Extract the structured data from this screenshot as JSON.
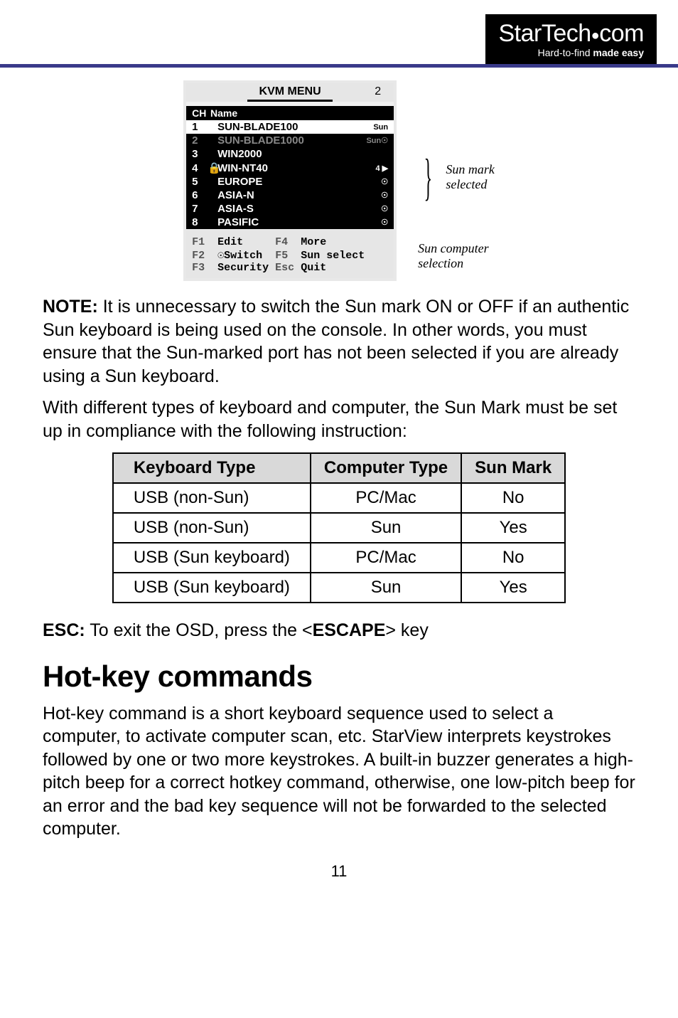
{
  "logo": {
    "main_a": "Star",
    "main_b": "Tech",
    "main_c": "com",
    "dot": "●",
    "sub_prefix": "Hard-to-find ",
    "sub_bold": "made easy"
  },
  "kvm": {
    "title": "KVM MENU",
    "page_num": "2",
    "header_ch": "CH",
    "header_name": "Name",
    "rows": [
      {
        "ch": "1",
        "lock": "",
        "name": "SUN-BLADE100",
        "mark": "Sun",
        "cls": "highlight"
      },
      {
        "ch": "2",
        "lock": "",
        "name": "SUN-BLADE1000",
        "mark": "Sun☉",
        "cls": "dim"
      },
      {
        "ch": "3",
        "lock": "",
        "name": "WIN2000",
        "mark": "",
        "cls": ""
      },
      {
        "ch": "4",
        "lock": "🔒",
        "name": "WIN-NT40",
        "mark": "4 ▶",
        "cls": ""
      },
      {
        "ch": "5",
        "lock": "",
        "name": "EUROPE",
        "mark": "☉",
        "cls": ""
      },
      {
        "ch": "6",
        "lock": "",
        "name": "ASIA-N",
        "mark": "☉",
        "cls": ""
      },
      {
        "ch": "7",
        "lock": "",
        "name": "ASIA-S",
        "mark": "☉",
        "cls": ""
      },
      {
        "ch": "8",
        "lock": "",
        "name": "PASIFIC",
        "mark": "☉",
        "cls": ""
      }
    ],
    "footer": {
      "f1": "F1",
      "f1_lbl": "Edit",
      "f4": "F4",
      "f4_lbl": "More",
      "f2": "F2",
      "f2_lbl": "☉Switch",
      "f5": "F5",
      "f5_lbl": "Sun select",
      "f3": "F3",
      "f3_lbl": "Security",
      "esc": "Esc",
      "esc_lbl": "Quit"
    }
  },
  "annot": {
    "mark1_l1": "Sun mark",
    "mark1_l2": "selected",
    "mark2_l1": "Sun computer",
    "mark2_l2": "selection"
  },
  "para1_prefix_bold": "NOTE:",
  "para1_rest": " It is unnecessary to switch the Sun mark ON or OFF if an authentic Sun keyboard is being used on the console. In other words, you must ensure that the Sun-marked port has not been selected if you are already using a Sun keyboard.",
  "para2": "With different types of keyboard and computer, the Sun Mark must be set up in compliance with the following instruction:",
  "table": {
    "h1": "Keyboard Type",
    "h2": "Computer Type",
    "h3": "Sun Mark",
    "rows": [
      {
        "c1": "USB (non-Sun)",
        "c2": "PC/Mac",
        "c3": "No"
      },
      {
        "c1": "USB (non-Sun)",
        "c2": "Sun",
        "c3": "Yes"
      },
      {
        "c1": "USB (Sun keyboard)",
        "c2": "PC/Mac",
        "c3": "No"
      },
      {
        "c1": "USB (Sun keyboard)",
        "c2": "Sun",
        "c3": "Yes"
      }
    ]
  },
  "esc_line_bold1": "ESC:",
  "esc_line_mid": " To exit the OSD, press the <",
  "esc_line_bold2": "ESCAPE",
  "esc_line_end": "> key",
  "section_heading": "Hot-key commands",
  "para3": "Hot-key command is a short keyboard sequence used to select a computer, to activate computer scan, etc. StarView interprets keystrokes followed by one or two more keystrokes. A built-in buzzer generates a high-pitch beep for a correct hotkey command, otherwise, one low-pitch beep for an error and the bad key sequence will not be forwarded to the selected computer.",
  "page_number": "11"
}
